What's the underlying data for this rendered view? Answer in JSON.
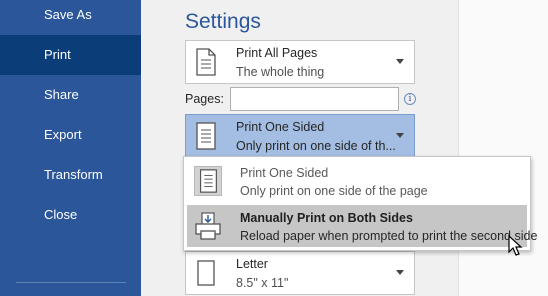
{
  "nav": {
    "items": [
      {
        "label": "Save As",
        "active": false
      },
      {
        "label": "Print",
        "active": true
      },
      {
        "label": "Share",
        "active": false
      },
      {
        "label": "Export",
        "active": false
      },
      {
        "label": "Transform",
        "active": false
      },
      {
        "label": "Close",
        "active": false
      }
    ]
  },
  "settings": {
    "title": "Settings",
    "print_range": {
      "label": "Print All Pages",
      "desc": "The whole thing",
      "icon": "document-icon"
    },
    "pages": {
      "label": "Pages:",
      "value": "",
      "info_icon": "info-icon"
    },
    "sides": {
      "label": "Print One Sided",
      "desc": "Only print on one side of th...",
      "icon": "one-sided-icon"
    },
    "paper": {
      "label": "Letter",
      "desc": "8.5\" x 11\"",
      "icon": "paper-icon"
    }
  },
  "popup": {
    "options": [
      {
        "label": "Print One Sided",
        "desc": "Only print on one side of the page",
        "icon": "one-sided-icon",
        "state": "current"
      },
      {
        "label": "Manually Print on Both Sides",
        "desc": "Reload paper when prompted to print the second side",
        "icon": "manual-duplex-icon",
        "state": "hover"
      }
    ]
  },
  "colors": {
    "nav_bg": "#2b579a",
    "nav_active": "#0b3d78",
    "title": "#2b579a",
    "selected": "#a3bde3",
    "hover": "#c6c6c6"
  }
}
